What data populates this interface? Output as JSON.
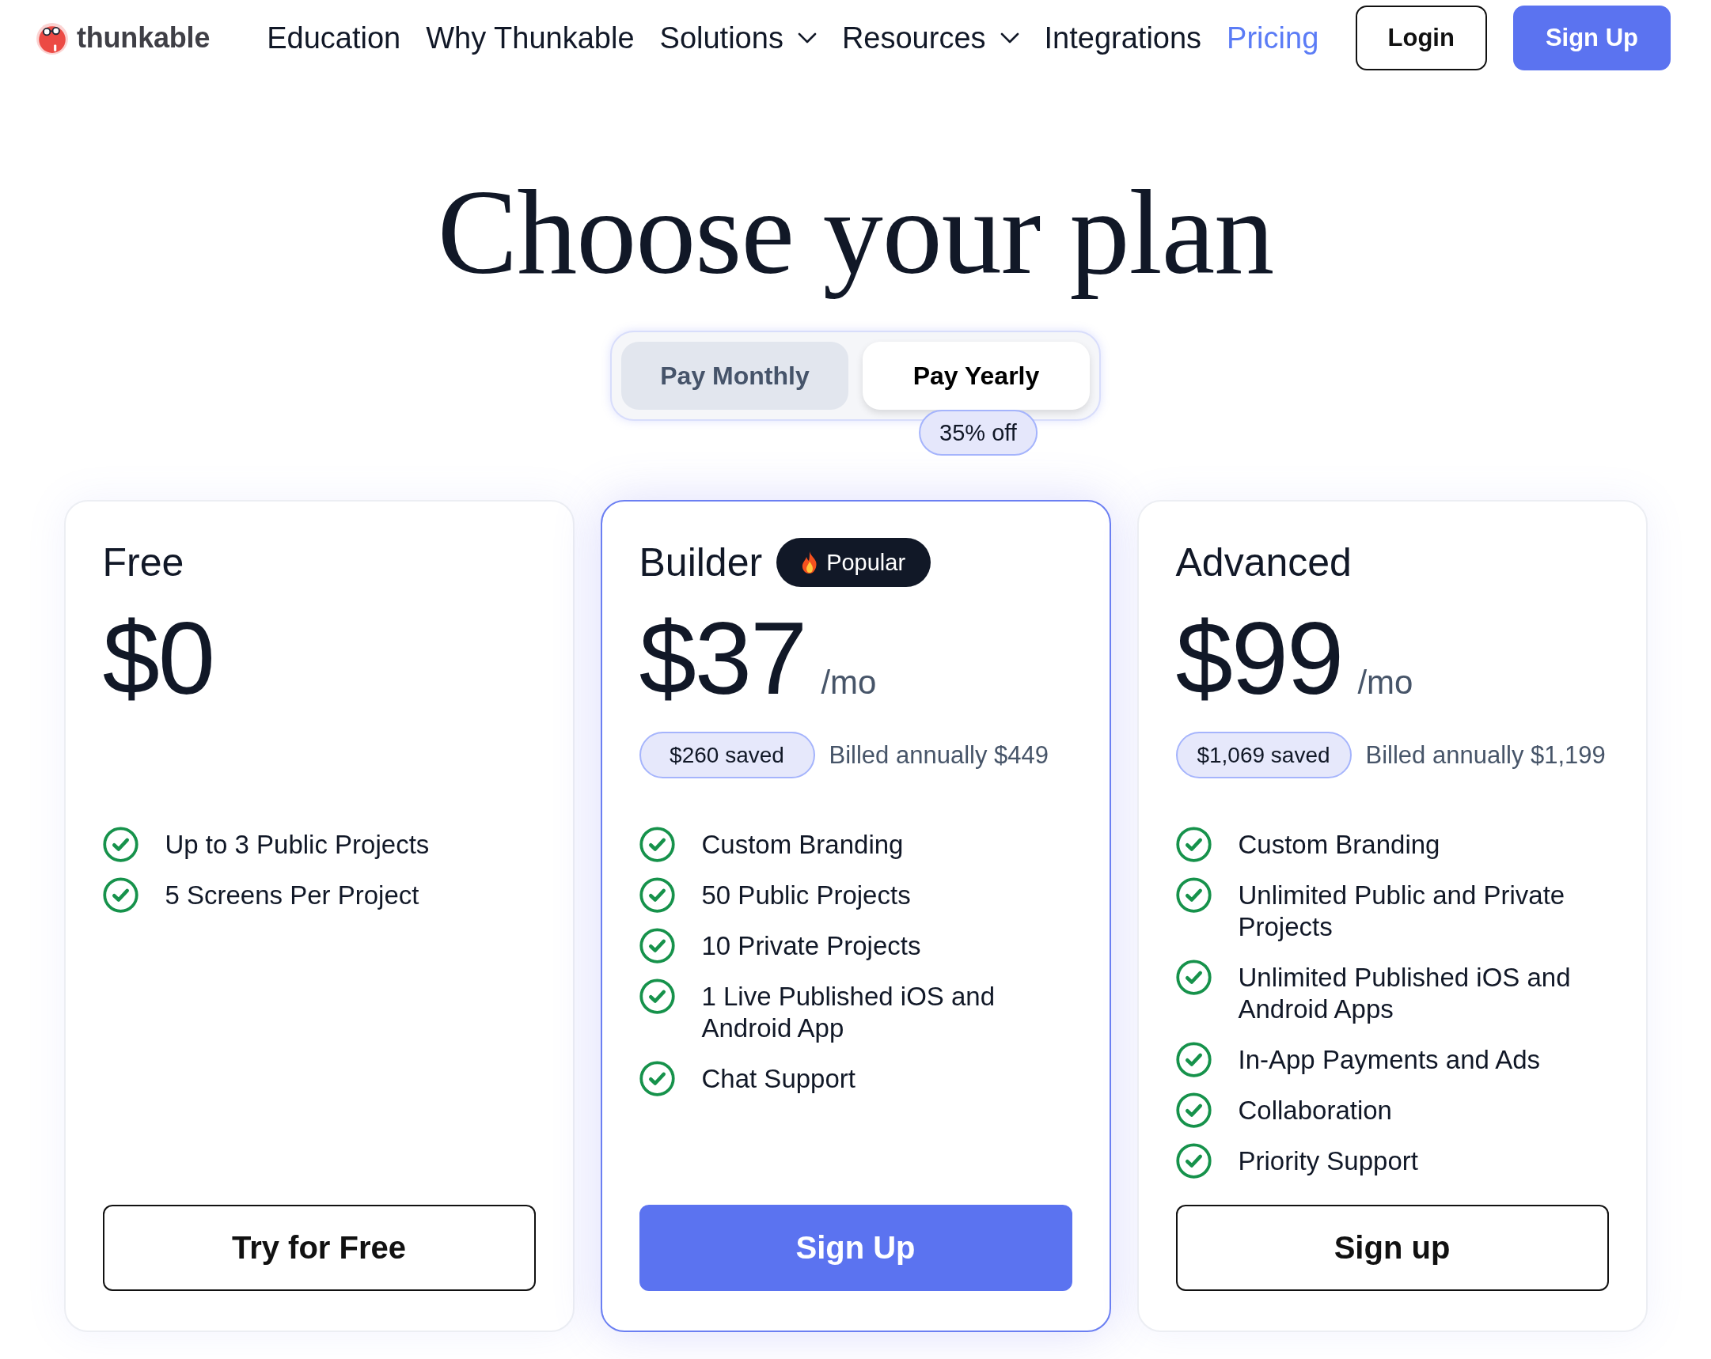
{
  "nav": {
    "logo": "thunkable",
    "links": [
      {
        "label": "Education",
        "dropdown": false,
        "selected": false
      },
      {
        "label": "Why Thunkable",
        "dropdown": false,
        "selected": false
      },
      {
        "label": "Solutions",
        "dropdown": true,
        "selected": false
      },
      {
        "label": "Resources",
        "dropdown": true,
        "selected": false
      },
      {
        "label": "Integrations",
        "dropdown": false,
        "selected": false
      },
      {
        "label": "Pricing",
        "dropdown": false,
        "selected": true
      }
    ],
    "buttons": [
      {
        "label": "Login",
        "primary": false
      },
      {
        "label": "Sign Up",
        "primary": true
      }
    ]
  },
  "hero": {
    "title": "Choose your plan"
  },
  "billing_toggle": {
    "options": [
      {
        "label": "Pay Monthly",
        "selected": false
      },
      {
        "label": "Pay Yearly",
        "selected": true,
        "badge": "35% off"
      }
    ]
  },
  "plans": [
    {
      "name": "Free",
      "highlighted": false,
      "price": "$0",
      "features": [
        "Up to 3 Public Projects",
        "5 Screens Per Project"
      ],
      "button": {
        "label": "Try for Free",
        "primary": false
      }
    },
    {
      "name": "Builder",
      "highlighted": true,
      "badge": "Popular",
      "price": "$37",
      "period": "/mo",
      "saved": "$260 saved",
      "billed": "Billed annually $449",
      "features": [
        "Custom Branding",
        "50 Public Projects",
        "10 Private Projects",
        "1 Live Published iOS and Android App",
        "Chat Support"
      ],
      "button": {
        "label": "Sign Up",
        "primary": true
      }
    },
    {
      "name": "Advanced",
      "highlighted": false,
      "price": "$99",
      "period": "/mo",
      "saved": "$1,069 saved",
      "billed": "Billed annually $1,199",
      "features": [
        "Custom Branding",
        "Unlimited Public and Private Projects",
        "Unlimited Published iOS and Android Apps",
        "In-App Payments and Ads",
        "Collaboration",
        "Priority Support"
      ],
      "button": {
        "label": "Sign up",
        "primary": false
      }
    }
  ]
}
